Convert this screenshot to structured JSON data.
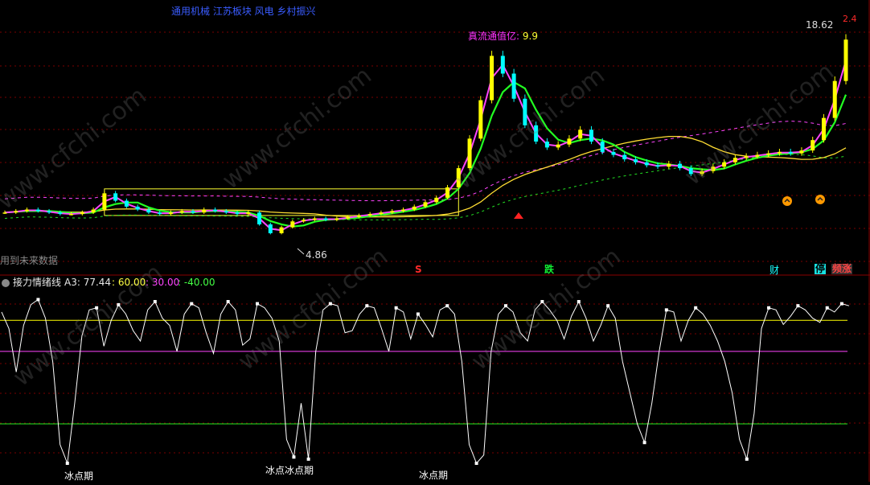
{
  "header": {
    "concept_tags": "通用机械 江苏板块 风电 乡村振兴",
    "circulation_label": "真流通值亿:",
    "circulation_value": "9.9",
    "max_price_label": "18.62",
    "min_price_label": "4.86",
    "future_data_note": "用到未来数据",
    "red_marker": "2.4"
  },
  "signals": {
    "s_mark": "S",
    "die": "跌",
    "cai": "财",
    "ting": "停",
    "zhang": "频涨"
  },
  "indicator": {
    "name": "接力情绪线",
    "a3_label": "A3: 77.44",
    "line1_label": ": 60.00",
    "line2_label": ": 30.00",
    "line3_label": ": -40.00",
    "ice_label_1": "冰点期",
    "ice_label_2": "冰点冰点期",
    "ice_label_3": "冰点期",
    "levels": {
      "upper": 60,
      "middle": 30,
      "lower": -40
    }
  },
  "watermark": "www.cfchi.com",
  "colors": {
    "bull": "#ffff00",
    "bear": "#00ffff",
    "ma_pink": "#ff44ff",
    "ma_green": "#22ff22",
    "ma_slow": "#ffdd33",
    "box": "#ffff33",
    "osc": "#ffffff"
  },
  "chart_data": {
    "type": "line",
    "price_extremes": {
      "max": 18.62,
      "min": 4.86
    },
    "ylim": [
      4.0,
      20.0
    ],
    "candles": [
      {
        "close": 6.6
      },
      {
        "close": 6.7
      },
      {
        "close": 6.8
      },
      {
        "close": 6.7
      },
      {
        "close": 6.6
      },
      {
        "close": 6.5
      },
      {
        "close": 6.5
      },
      {
        "close": 6.6
      },
      {
        "close": 6.8
      },
      {
        "close": 7.9
      },
      {
        "close": 7.4
      },
      {
        "close": 7.0
      },
      {
        "close": 6.8
      },
      {
        "close": 6.6
      },
      {
        "close": 6.5
      },
      {
        "close": 6.6
      },
      {
        "close": 6.7
      },
      {
        "close": 6.6
      },
      {
        "close": 6.8
      },
      {
        "close": 6.7
      },
      {
        "close": 6.6
      },
      {
        "close": 6.5
      },
      {
        "close": 6.6
      },
      {
        "close": 5.8
      },
      {
        "close": 5.2
      },
      {
        "close": 5.6
      },
      {
        "close": 6.0
      },
      {
        "close": 6.1
      },
      {
        "close": 6.2
      },
      {
        "close": 6.1
      },
      {
        "close": 6.2
      },
      {
        "close": 6.3
      },
      {
        "close": 6.4
      },
      {
        "close": 6.5
      },
      {
        "close": 6.6
      },
      {
        "close": 6.7
      },
      {
        "close": 6.8
      },
      {
        "close": 7.0
      },
      {
        "close": 7.3
      },
      {
        "close": 7.6
      },
      {
        "close": 8.3
      },
      {
        "close": 9.6
      },
      {
        "close": 11.6
      },
      {
        "close": 14.2
      },
      {
        "close": 17.2
      },
      {
        "close": 16.0
      },
      {
        "close": 14.3
      },
      {
        "close": 12.5
      },
      {
        "close": 11.4
      },
      {
        "close": 11.0
      },
      {
        "close": 11.2
      },
      {
        "close": 11.6
      },
      {
        "close": 12.2
      },
      {
        "close": 11.4
      },
      {
        "close": 10.7
      },
      {
        "close": 10.5
      },
      {
        "close": 10.2
      },
      {
        "close": 10.0
      },
      {
        "close": 9.8
      },
      {
        "close": 9.7
      },
      {
        "close": 9.9
      },
      {
        "close": 9.6
      },
      {
        "close": 9.2
      },
      {
        "close": 9.4
      },
      {
        "close": 9.7
      },
      {
        "close": 10.0
      },
      {
        "close": 10.3
      },
      {
        "close": 10.4
      },
      {
        "close": 10.5
      },
      {
        "close": 10.6
      },
      {
        "close": 10.7
      },
      {
        "close": 10.6
      },
      {
        "close": 10.8
      },
      {
        "close": 11.5
      },
      {
        "close": 13.0
      },
      {
        "close": 15.5
      },
      {
        "close": 18.3
      }
    ],
    "oscillator": [
      68,
      52,
      10,
      55,
      75,
      80,
      62,
      20,
      -60,
      -78,
      -20,
      45,
      70,
      72,
      35,
      60,
      75,
      66,
      50,
      40,
      70,
      78,
      62,
      55,
      30,
      66,
      76,
      72,
      48,
      28,
      66,
      78,
      70,
      36,
      42,
      76,
      72,
      62,
      40,
      -55,
      -72,
      -20,
      -74,
      30,
      70,
      76,
      74,
      48,
      50,
      66,
      74,
      72,
      52,
      30,
      72,
      68,
      42,
      66,
      56,
      44,
      70,
      74,
      66,
      20,
      -60,
      -78,
      -70,
      30,
      66,
      74,
      68,
      48,
      40,
      70,
      78,
      70,
      60,
      42,
      64,
      78,
      62,
      40,
      55,
      74,
      62,
      20,
      -10,
      -40,
      -58,
      -20,
      30,
      70,
      68,
      40,
      60,
      72,
      66,
      55,
      40,
      20,
      -10,
      -55,
      -74,
      -30,
      52,
      72,
      70,
      56,
      64,
      74,
      70,
      62,
      58,
      72,
      68,
      76,
      74
    ]
  }
}
